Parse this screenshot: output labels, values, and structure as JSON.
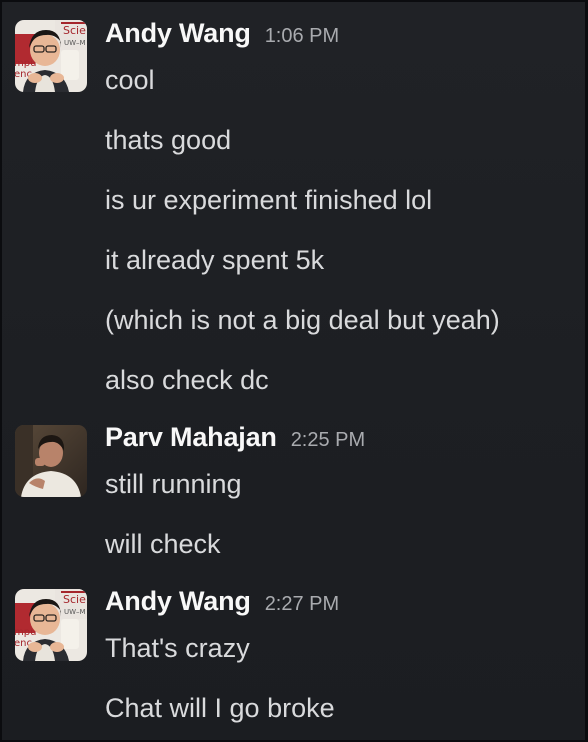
{
  "groups": [
    {
      "author": "Andy Wang",
      "time": "1:06 PM",
      "avatar": "andy-wang-avatar",
      "messages": [
        "cool",
        "thats good",
        "is ur experiment finished lol",
        "it already spent 5k",
        "(which is not a big deal but yeah)",
        "also check dc"
      ]
    },
    {
      "author": "Parv Mahajan",
      "time": "2:25 PM",
      "avatar": "parv-mahajan-avatar",
      "messages": [
        "still running",
        "will check"
      ]
    },
    {
      "author": "Andy Wang",
      "time": "2:27 PM",
      "avatar": "andy-wang-avatar",
      "messages": [
        "That's crazy",
        "Chat will I go broke"
      ]
    }
  ],
  "colors": {
    "background": "#1d1f23",
    "author": "#f8f8f8",
    "timestamp": "#a9abaf",
    "message": "#d9dadc"
  }
}
